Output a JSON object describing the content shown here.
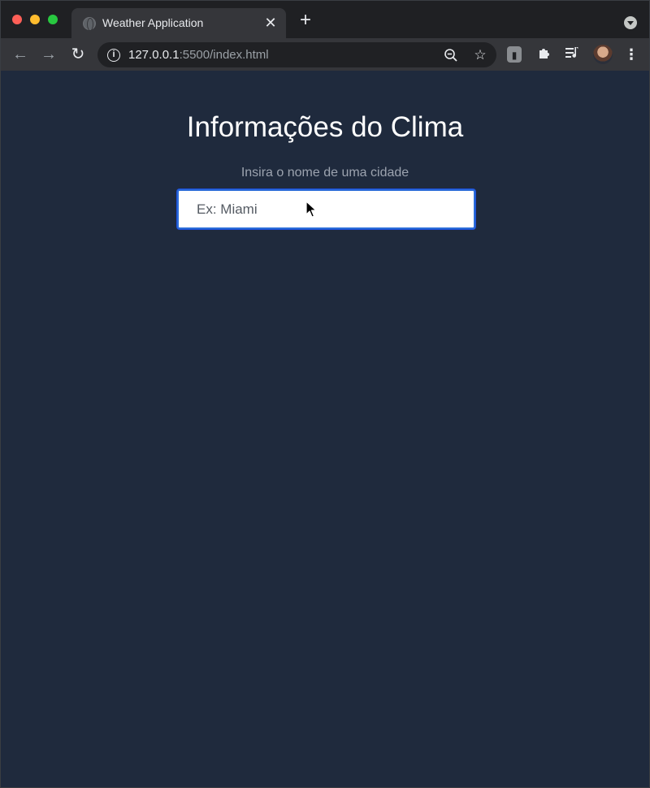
{
  "browser": {
    "tab_title": "Weather Application",
    "tab_close_icon": "close-icon",
    "new_tab_icon": "plus-icon",
    "url_host": "127.0.0.1",
    "url_rest": ":5500/index.html",
    "icons": [
      "back-arrow-icon",
      "forward-arrow-icon",
      "reload-icon",
      "info-icon",
      "zoom-out-icon",
      "star-icon",
      "extension-icon",
      "puzzle-icon",
      "media-icon",
      "avatar",
      "menu-icon"
    ]
  },
  "page": {
    "title": "Informações do Clima",
    "subtitle": "Insira o nome de uma cidade",
    "input_placeholder": "Ex: Miami",
    "input_value": ""
  },
  "colors": {
    "background": "#1f2a3d",
    "input_focus_border": "#2b6cd9",
    "title": "#ffffff",
    "subtitle": "#9ca3af"
  }
}
